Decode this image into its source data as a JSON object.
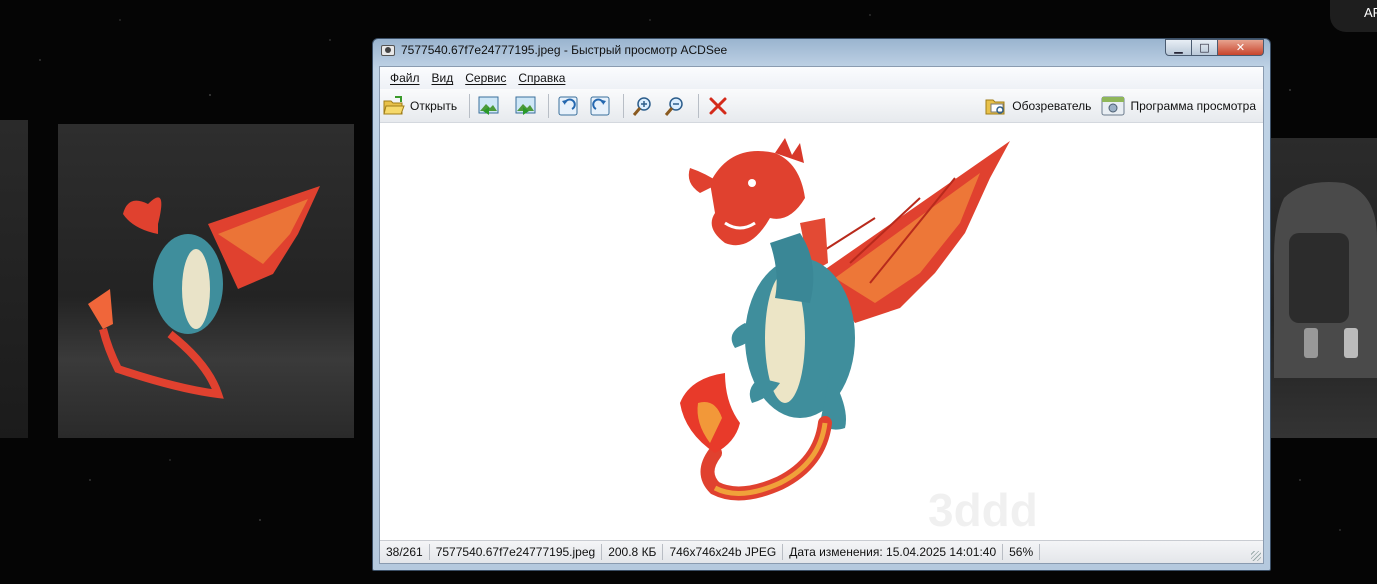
{
  "window": {
    "title": "7577540.67f7e24777195.jpeg - Быстрый просмотр ACDSee",
    "controls": {
      "minimize": "▁",
      "maximize": "□",
      "close": "✕"
    }
  },
  "menu": [
    "Файл",
    "Вид",
    "Сервис",
    "Справка"
  ],
  "toolbar": {
    "open_label": "Открыть",
    "browser_label": "Обозреватель",
    "viewer_label": "Программа просмотра",
    "icons": [
      "open-folder-icon",
      "previous-image-icon",
      "next-image-icon",
      "rotate-left-icon",
      "rotate-right-icon",
      "zoom-in-icon",
      "zoom-out-icon",
      "delete-icon",
      "browser-icon",
      "viewer-program-icon"
    ]
  },
  "image": {
    "watermark": "3ddd"
  },
  "status": {
    "position": "38/261",
    "filename": "7577540.67f7e24777195.jpeg",
    "filesize": "200.8 КБ",
    "dimensions": "746x746x24b JPEG",
    "modified": "Дата изменения: 15.04.2025 14:01:40",
    "zoom": "56%"
  },
  "background": {
    "corner_label": "AF"
  },
  "colors": {
    "accent": "#c8442c",
    "dragon_red": "#e23b2a",
    "dragon_teal": "#3f8e9c"
  }
}
